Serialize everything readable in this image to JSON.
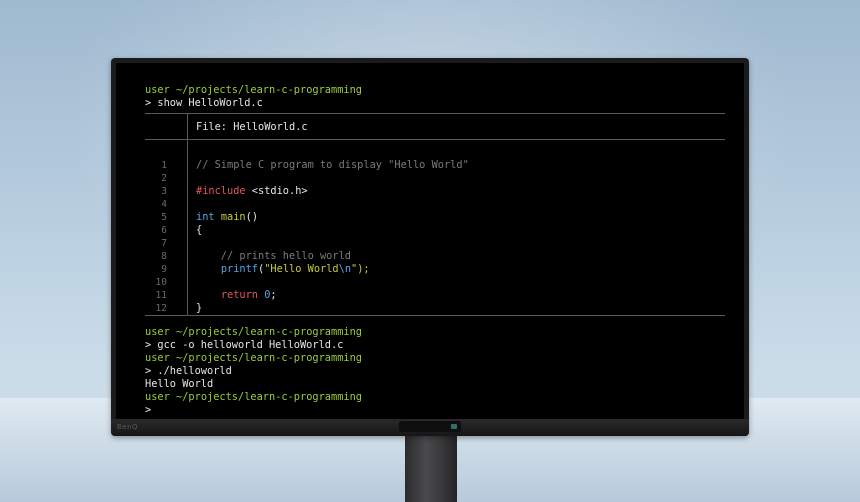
{
  "terminal": {
    "prompt_user_1": "user",
    "prompt_path_1": "~/projects/learn-c-programming",
    "command_1": "> show HelloWorld.c",
    "file_header": "File: HelloWorld.c",
    "code_lines": [
      {
        "num": "1",
        "text": "// Simple C program to display \"Hello World\""
      },
      {
        "num": "2",
        "text": ""
      },
      {
        "num": "3",
        "text": "#include <stdio.h>"
      },
      {
        "num": "4",
        "text": ""
      },
      {
        "num": "5",
        "text": "int main()"
      },
      {
        "num": "6",
        "text": "{"
      },
      {
        "num": "7",
        "text": ""
      },
      {
        "num": "8",
        "text": "    // prints hello world"
      },
      {
        "num": "9",
        "text": "    printf(\"Hello World\\n\");"
      },
      {
        "num": "10",
        "text": ""
      },
      {
        "num": "11",
        "text": "    return 0;"
      },
      {
        "num": "12",
        "text": "}"
      }
    ],
    "prompt_user_2": "user",
    "prompt_path_2": "~/projects/learn-c-programming",
    "command_2": "> gcc -o helloworld HelloWorld.c",
    "prompt_user_3": "user",
    "prompt_path_3": "~/projects/learn-c-programming",
    "command_3": "> ./helloworld",
    "output_1": "Hello World",
    "prompt_user_4": "user",
    "prompt_path_4": "~/projects/learn-c-programming",
    "command_4": ">"
  },
  "monitor": {
    "brand": "BenQ"
  },
  "colors": {
    "prompt_green": "#9ccc3a",
    "preprocessor_red": "#e0555f",
    "keyword_blue": "#52a7dc",
    "function_yellow": "#c9c93a",
    "comment_gray": "#7a7a7a"
  }
}
